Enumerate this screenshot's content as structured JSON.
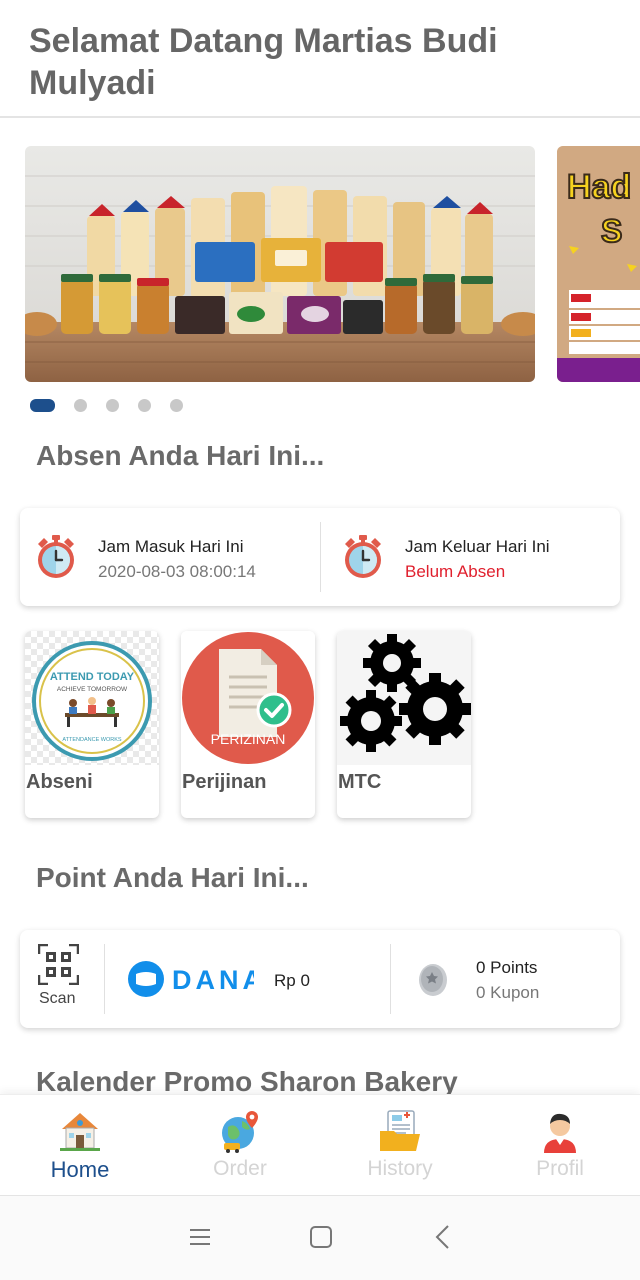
{
  "header": {
    "title": "Selamat Datang Martias Budi Mulyadi"
  },
  "carousel": {
    "slide_count": 5,
    "active_index": 0,
    "banner1_icon": "bakery-products-banner",
    "banner2_icon": "promo-banner"
  },
  "attendance": {
    "title": "Absen Anda Hari Ini...",
    "check_in": {
      "label": "Jam Masuk Hari Ini",
      "value": "2020-08-03 08:00:14",
      "icon": "alarm-clock-icon"
    },
    "check_out": {
      "label": "Jam Keluar Hari Ini",
      "value": "Belum Absen",
      "value_color": "#e0202e",
      "icon": "alarm-clock-icon"
    }
  },
  "menu": [
    {
      "label": "Abseni",
      "icon": "attend-today-icon",
      "image_text": [
        "ATTEND TODAY",
        "ACHIEVE TOMORROW",
        "ATTENDANCE WORKS"
      ]
    },
    {
      "label": "Perijinan",
      "icon": "permit-document-icon",
      "image_text": [
        "PERIZINAN"
      ]
    },
    {
      "label": "MTC",
      "icon": "gears-icon"
    }
  ],
  "points": {
    "title": "Point Anda Hari Ini...",
    "scan_label": "Scan",
    "dana_brand": "DANA",
    "dana_balance": "Rp 0",
    "points_value": "0 Points",
    "kupon_value": "0 Kupon"
  },
  "promo": {
    "title": "Kalender Promo Sharon Bakery"
  },
  "nav": {
    "items": [
      {
        "label": "Home",
        "icon": "home-icon",
        "active": true
      },
      {
        "label": "Order",
        "icon": "globe-order-icon",
        "active": false
      },
      {
        "label": "History",
        "icon": "history-folder-icon",
        "active": false
      },
      {
        "label": "Profil",
        "icon": "profile-avatar-icon",
        "active": false
      }
    ]
  },
  "colors": {
    "accent": "#1d4f8c",
    "alert": "#e0202e",
    "dana": "#118eea",
    "permit_red": "#e05a4b"
  }
}
